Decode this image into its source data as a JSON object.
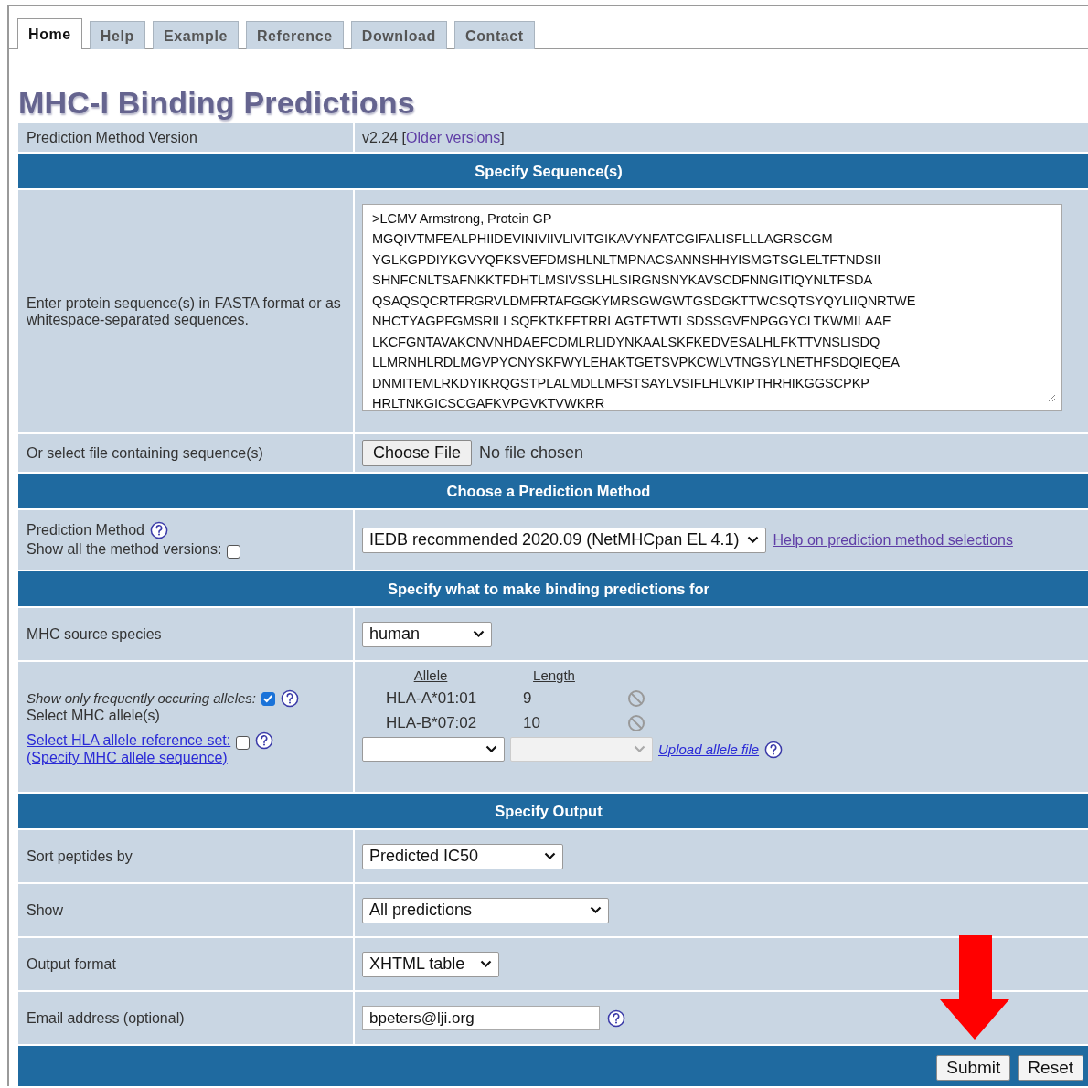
{
  "tabs": [
    {
      "label": "Home",
      "selected": true
    },
    {
      "label": "Help",
      "selected": false
    },
    {
      "label": "Example",
      "selected": false
    },
    {
      "label": "Reference",
      "selected": false
    },
    {
      "label": "Download",
      "selected": false
    },
    {
      "label": "Contact",
      "selected": false
    }
  ],
  "title": "MHC-I Binding Predictions",
  "version": {
    "label": "Prediction Method Version",
    "prefix": "v2.24 [",
    "link": "Older versions",
    "suffix": "]"
  },
  "sections": [
    {
      "header": "Specify Sequence(s)",
      "rows": [
        {
          "kind": "sequence",
          "label": "Enter protein sequence(s) in FASTA format or as whitespace-separated sequences.",
          "value": ">LCMV Armstrong, Protein GP\nMGQIVTMFEALPHIIDEVINIVIIVLIVITGIKAVYNFATCGIFALISFLLLAGRSCGM\nYGLKGPDIYKGVYQFKSVEFDMSHLNLTMPNACSANNSHHYISMGTSGLELTFTNDSII\nSHNFCNLTSAFNKKTFDHTLMSIVSSLHLSIRGNSNYKAVSCDFNNGITIQYNLTFSDA\nQSAQSQCRTFRGRVLDMFRTAFGGKYMRSGWGWTGSDGKTTWCSQTSYQYLIIQNRTWE\nNHCTYAGPFGMSRILLSQEKTKFFTRRLAGTFTWTLSDSSGVENPGGYCLTKWMILAAE\nLKCFGNTAVAKCNVNHDAEFCDMLRLIDYNKAALSKFKEDVESALHLFKTTVNSLISDQ\nLLMRNHLRDLMGVPYCNYSKFWYLEHAKTGETSVPKCWLVTNGSYLNETHFSDQIEQEA\nDNMITEMLRKDYIKRQGSTPLALMDLLMFSTSAYLVSIFLHLVKIPTHRHIKGGSCPKP\nHRLTNKGICSCGAFKVPGVKTVWKRR"
        },
        {
          "kind": "file",
          "label": "Or select file containing sequence(s)",
          "button": "Choose File",
          "status": "No file chosen"
        }
      ]
    },
    {
      "header": "Choose a Prediction Method",
      "rows": [
        {
          "kind": "method",
          "label": "Prediction Method",
          "checkbox_label": "Show all the method versions:",
          "checked": false,
          "value": "IEDB recommended 2020.09 (NetMHCpan EL 4.1)",
          "link": "Help on prediction method selections"
        }
      ]
    },
    {
      "header": "Specify what to make binding predictions for",
      "rows": [
        {
          "kind": "select",
          "label": "MHC source species",
          "value": "human"
        },
        {
          "kind": "alleles",
          "frequent_label": "Show only frequently occuring alleles:",
          "frequent_checked": true,
          "label": "Select MHC allele(s)",
          "reference_link": "Select HLA allele reference set:",
          "reference_checked": false,
          "sequence_link": "(Specify MHC allele sequence)",
          "columns": [
            "Allele",
            "Length"
          ],
          "alleles": [
            {
              "allele": "HLA-A*01:01",
              "length": "9"
            },
            {
              "allele": "HLA-B*07:02",
              "length": "10"
            }
          ],
          "length_disabled": true,
          "upload_link": "Upload allele file"
        }
      ]
    },
    {
      "header": "Specify Output",
      "rows": [
        {
          "kind": "select",
          "label": "Sort peptides by",
          "value": "Predicted IC50"
        },
        {
          "kind": "select",
          "label": "Show",
          "value": "All predictions"
        },
        {
          "kind": "select",
          "label": "Output format",
          "value": "XHTML table"
        },
        {
          "kind": "input",
          "label": "Email address (optional)",
          "value": "bpeters@lji.org"
        }
      ]
    }
  ],
  "buttons": [
    "Submit",
    "Reset"
  ]
}
